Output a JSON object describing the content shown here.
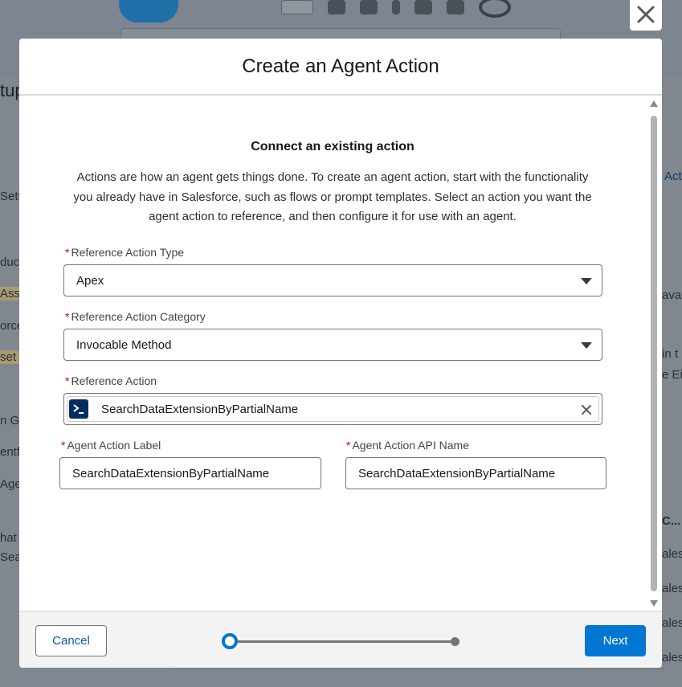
{
  "background": {
    "setup_label": "tup",
    "left_fragments": [
      "Setti",
      "duc",
      "Ass",
      "orce",
      "set I",
      "n G",
      "entf",
      "Age",
      "hat y",
      "Sear"
    ],
    "right_fragments": [
      "Acti",
      "avai",
      "in t",
      "e Ei",
      "C...",
      "ales",
      "ales",
      "ales",
      "ales"
    ]
  },
  "modal": {
    "title": "Create an Agent Action",
    "close_icon": "close-icon",
    "section_title": "Connect an existing action",
    "section_description": "Actions are how an agent gets things done. To create an agent action, start with the functionality you already have in Salesforce, such as flows or prompt templates. Select an action you want the agent action to reference, and then configure it for use with an agent.",
    "required_marker": "*",
    "fields": {
      "reference_action_type": {
        "label": "Reference Action Type",
        "value": "Apex"
      },
      "reference_action_category": {
        "label": "Reference Action Category",
        "value": "Invocable Method"
      },
      "reference_action": {
        "label": "Reference Action",
        "value": "SearchDataExtensionByPartialName",
        "icon": "apex-icon"
      },
      "agent_action_label": {
        "label": "Agent Action Label",
        "value": "SearchDataExtensionByPartialName"
      },
      "agent_action_api_name": {
        "label": "Agent Action API Name",
        "value": "SearchDataExtensionByPartialName"
      }
    },
    "footer": {
      "cancel_label": "Cancel",
      "next_label": "Next",
      "progress": {
        "current_step": 1,
        "total_steps": 2
      }
    }
  },
  "colors": {
    "brand": "#0176d3",
    "required": "#ba0517",
    "overlay": "#7f8790"
  }
}
